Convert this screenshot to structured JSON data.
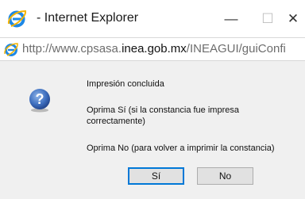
{
  "window": {
    "title": "- Internet Explorer",
    "minimize_glyph": "—",
    "maximize_glyph": "☐",
    "close_glyph": "✕"
  },
  "address": {
    "url_prefix": "http://www.cpsasa.",
    "url_host": "inea.gob.mx",
    "url_suffix": "/INEAGUI/guiConfi"
  },
  "dialog": {
    "icon": "question-icon",
    "line1": "Impresión concluida",
    "line2": "Oprima Sí (si la constancia fue impresa correctamente)",
    "line3": "Oprima No (para volver a imprimir la constancia)",
    "yes_label": "Sí",
    "no_label": "No"
  },
  "colors": {
    "accent": "#0078d7",
    "ie_blue": "#1e88e5",
    "ie_ring": "#f5b400"
  }
}
